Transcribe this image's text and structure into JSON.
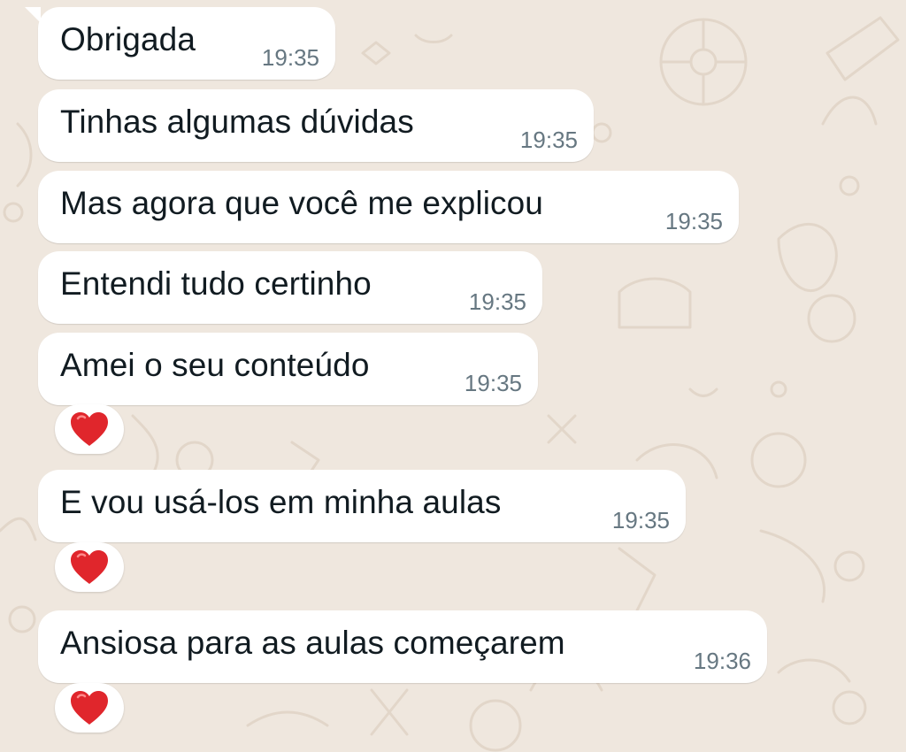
{
  "colors": {
    "wallpaper": "#efe7de",
    "bubble": "#ffffff",
    "text": "#111b21",
    "time": "#667781",
    "heart": "#e0262c"
  },
  "messages": [
    {
      "text": "Obrigada",
      "time": "19:35"
    },
    {
      "text": "Tinhas algumas dúvidas",
      "time": "19:35"
    },
    {
      "text": "Mas agora que você me explicou",
      "time": "19:35"
    },
    {
      "text": "Entendi tudo certinho",
      "time": "19:35"
    },
    {
      "text": "Amei o seu conteúdo",
      "time": "19:35",
      "reaction": "heart-icon"
    },
    {
      "text": "E vou usá-los em minha aulas",
      "time": "19:35",
      "reaction": "heart-icon"
    },
    {
      "text": "Ansiosa para as aulas começarem",
      "time": "19:36",
      "reaction": "heart-icon"
    }
  ]
}
